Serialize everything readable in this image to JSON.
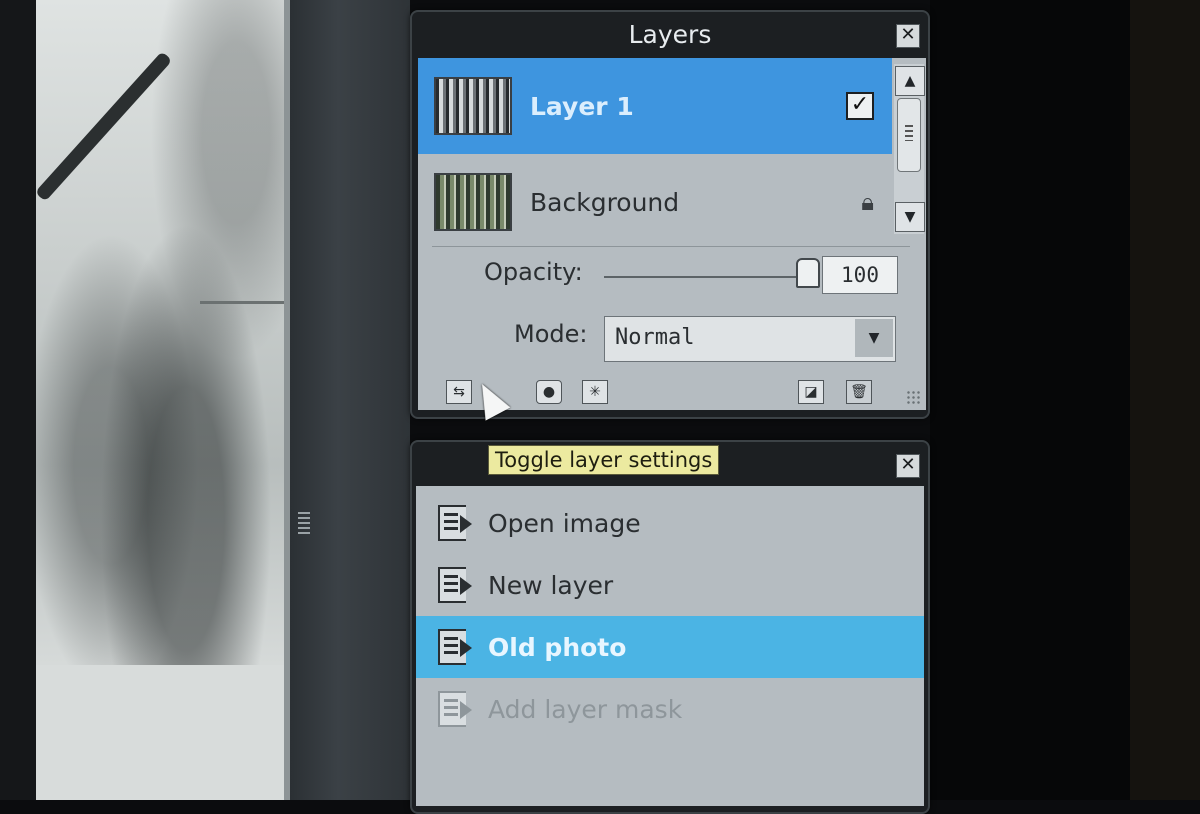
{
  "layers_panel": {
    "title": "Layers",
    "close_icon": "close-icon",
    "layers": [
      {
        "name": "Layer 1",
        "selected": true,
        "visible": true,
        "indicator": "checkbox-icon"
      },
      {
        "name": "Background",
        "selected": false,
        "locked": true,
        "indicator": "lock-icon"
      }
    ],
    "opacity_label": "Opacity:",
    "opacity_value": "100",
    "opacity_fraction": 1.0,
    "mode_label": "Mode:",
    "mode_value": "Normal",
    "toolbar": [
      "layer-settings-icon",
      "layer-mask-icon",
      "layer-styles-icon",
      "new-layer-icon",
      "trash-icon"
    ]
  },
  "tooltip": "Toggle layer settings",
  "history_panel": {
    "close_icon": "close-icon",
    "items": [
      {
        "label": "Open image",
        "state": "done"
      },
      {
        "label": "New layer",
        "state": "done"
      },
      {
        "label": "Old photo",
        "state": "current"
      },
      {
        "label": "Add layer mask",
        "state": "undone"
      }
    ]
  },
  "colors": {
    "selection_blue": "#3e95df",
    "history_current": "#4bb4e4",
    "tooltip_bg": "#eceaa0",
    "panel_bg": "#1c1f22"
  }
}
